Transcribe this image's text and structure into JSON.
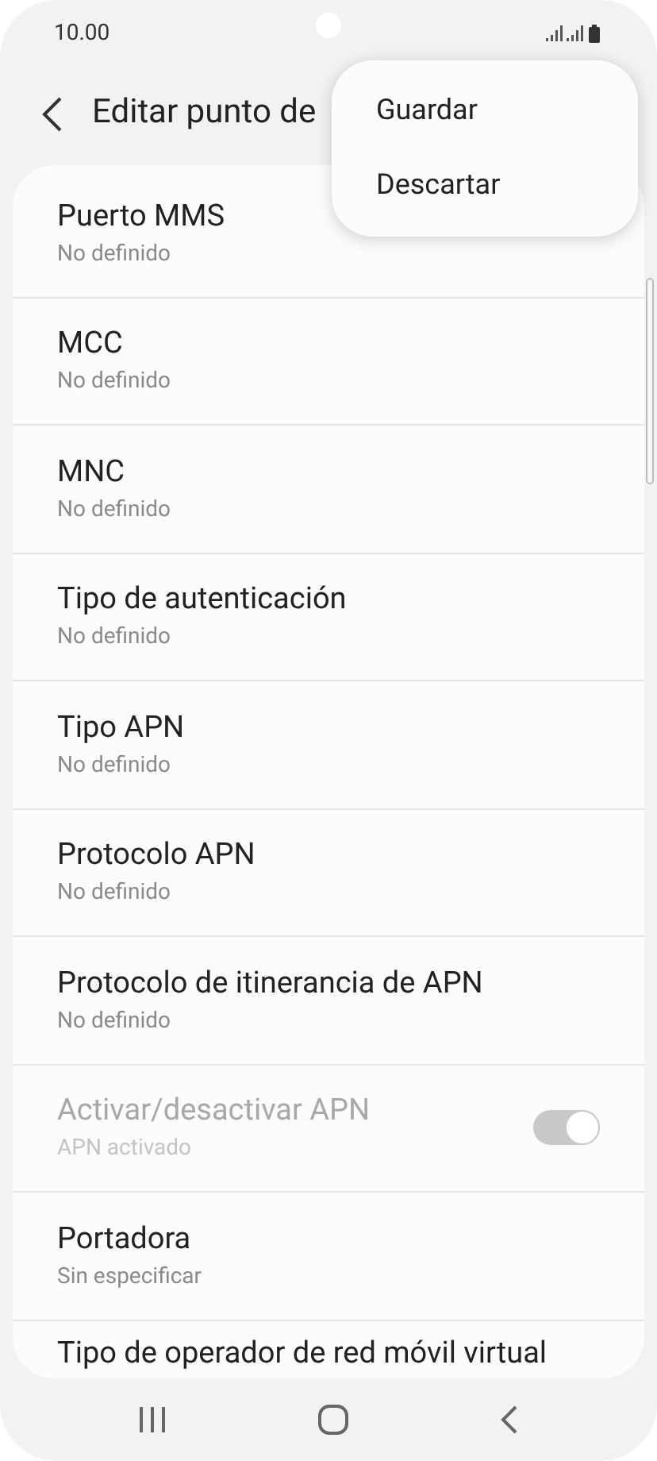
{
  "status_bar": {
    "time": "10.00"
  },
  "header": {
    "title": "Editar punto de"
  },
  "menu": {
    "items": [
      {
        "label": "Guardar"
      },
      {
        "label": "Descartar"
      }
    ]
  },
  "settings": [
    {
      "kind": "value",
      "title": "Puerto MMS",
      "subtitle": "No definido",
      "disabled": false
    },
    {
      "kind": "value",
      "title": "MCC",
      "subtitle": "No definido",
      "disabled": false
    },
    {
      "kind": "value",
      "title": "MNC",
      "subtitle": "No definido",
      "disabled": false
    },
    {
      "kind": "value",
      "title": "Tipo de autenticación",
      "subtitle": "No definido",
      "disabled": false
    },
    {
      "kind": "value",
      "title": "Tipo APN",
      "subtitle": "No definido",
      "disabled": false
    },
    {
      "kind": "value",
      "title": "Protocolo APN",
      "subtitle": "No definido",
      "disabled": false
    },
    {
      "kind": "value",
      "title": "Protocolo de itinerancia de APN",
      "subtitle": "No definido",
      "disabled": false
    },
    {
      "kind": "toggle",
      "title": "Activar/desactivar APN",
      "subtitle": "APN activado",
      "disabled": true,
      "on": true
    },
    {
      "kind": "value",
      "title": "Portadora",
      "subtitle": "Sin especificar",
      "disabled": false
    },
    {
      "kind": "value",
      "title": "Tipo de operador de red móvil virtual",
      "disabled": false
    }
  ]
}
